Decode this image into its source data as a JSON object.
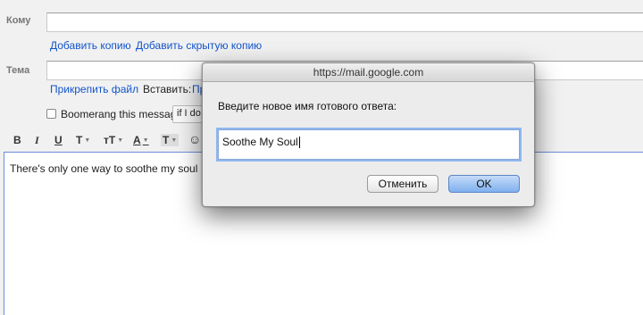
{
  "compose": {
    "to_label": "Кому",
    "add_cc": "Добавить копию",
    "add_bcc": "Добавить скрытую копию",
    "subject_label": "Тема",
    "attach_file": "Прикрепить файл",
    "insert_label": "Вставить:",
    "insert_partial": "Пр",
    "boomerang_label": "Boomerang this message",
    "boomerang_value": "if I do",
    "body_text": "There's only one way to soothe my soul"
  },
  "toolbar": {
    "bold": "B",
    "italic": "I",
    "underline": "U",
    "font": "T",
    "size": "тT",
    "text_color": "A",
    "highlight": "T",
    "emoji": "☺"
  },
  "dialog": {
    "title": "https://mail.google.com",
    "prompt": "Введите новое имя готового ответа:",
    "input_value": "Soothe My Soul",
    "cancel_label": "Отменить",
    "ok_label": "OK"
  }
}
